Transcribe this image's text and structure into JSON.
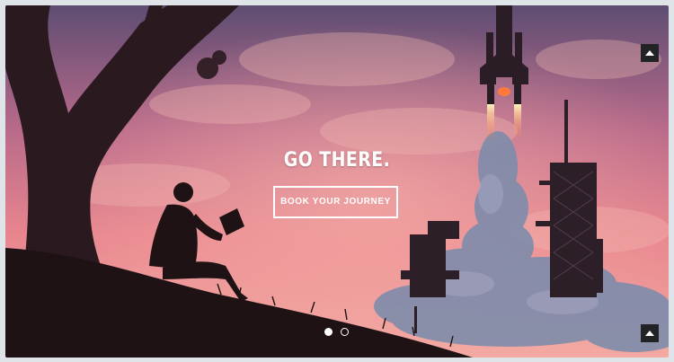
{
  "hero": {
    "headline": "GO THERE.",
    "cta_label": "BOOK YOUR JOURNEY"
  },
  "carousel": {
    "slide_count": 2,
    "active_index": 0
  },
  "colors": {
    "sky_top": "#5b4b6e",
    "sky_mid": "#e07f8c",
    "sky_bottom": "#f2a8a4",
    "silhouette": "#2a1a1f",
    "smoke": "#7b8aa8",
    "button_bg": "#222325"
  },
  "icons": {
    "scroll_up": "caret-up-icon",
    "scroll_down": "caret-up-icon"
  }
}
